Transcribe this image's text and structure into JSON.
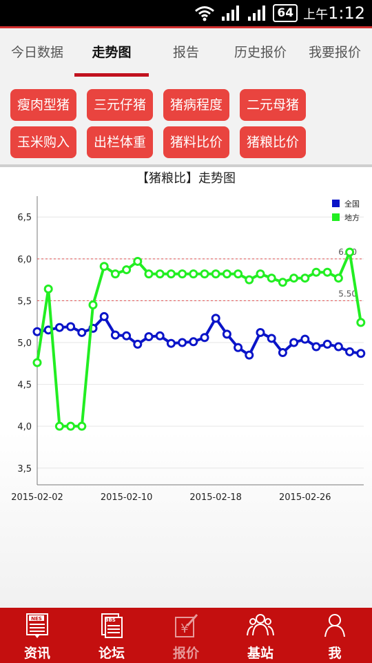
{
  "status_bar": {
    "network": "64",
    "time_prefix": "上午",
    "time": "1:12"
  },
  "tabs": [
    {
      "label": "今日数据",
      "active": false
    },
    {
      "label": "走势图",
      "active": true
    },
    {
      "label": "报告",
      "active": false
    },
    {
      "label": "历史报价",
      "active": false
    },
    {
      "label": "我要报价",
      "active": false
    }
  ],
  "categories": [
    "瘦肉型猪",
    "三元仔猪",
    "猪病程度",
    "二元母猪",
    "玉米购入",
    "出栏体重",
    "猪料比价",
    "猪粮比价"
  ],
  "chart_data": {
    "type": "line",
    "title": "【猪粮比】走势图",
    "x_tick_labels": [
      "2015-02-02",
      "2015-02-10",
      "2015-02-18",
      "2015-02-26"
    ],
    "y_tick_labels": [
      "3,5",
      "4,0",
      "4,5",
      "5,0",
      "5,5",
      "6,0",
      "6,5"
    ],
    "ylim": [
      3.3,
      6.7
    ],
    "reference_lines": [
      {
        "value": 6.0,
        "label": "6.00"
      },
      {
        "value": 5.5,
        "label": "5.50"
      }
    ],
    "legend_position": "top-right",
    "series": [
      {
        "name": "全国",
        "color": "#0a14c8",
        "values": [
          5.13,
          5.15,
          5.18,
          5.19,
          5.12,
          5.17,
          5.31,
          5.09,
          5.08,
          4.98,
          5.07,
          5.08,
          4.99,
          5.0,
          5.01,
          5.06,
          5.29,
          5.1,
          4.94,
          4.85,
          5.12,
          5.05,
          4.88,
          5.0,
          5.04,
          4.95,
          4.98,
          4.95,
          4.89,
          4.87
        ]
      },
      {
        "name": "地方",
        "color": "#22ee22",
        "values": [
          4.76,
          5.64,
          4.0,
          4.0,
          4.0,
          5.45,
          5.91,
          5.82,
          5.87,
          5.97,
          5.82,
          5.82,
          5.82,
          5.82,
          5.82,
          5.82,
          5.82,
          5.82,
          5.82,
          5.75,
          5.82,
          5.77,
          5.72,
          5.77,
          5.77,
          5.84,
          5.84,
          5.77,
          6.08,
          5.24
        ]
      }
    ]
  },
  "bottom_nav": [
    {
      "label": "资讯",
      "icon": "news-icon"
    },
    {
      "label": "论坛",
      "icon": "bbs-icon"
    },
    {
      "label": "报价",
      "icon": "price-icon"
    },
    {
      "label": "基站",
      "icon": "group-icon"
    },
    {
      "label": "我",
      "icon": "user-icon"
    }
  ]
}
